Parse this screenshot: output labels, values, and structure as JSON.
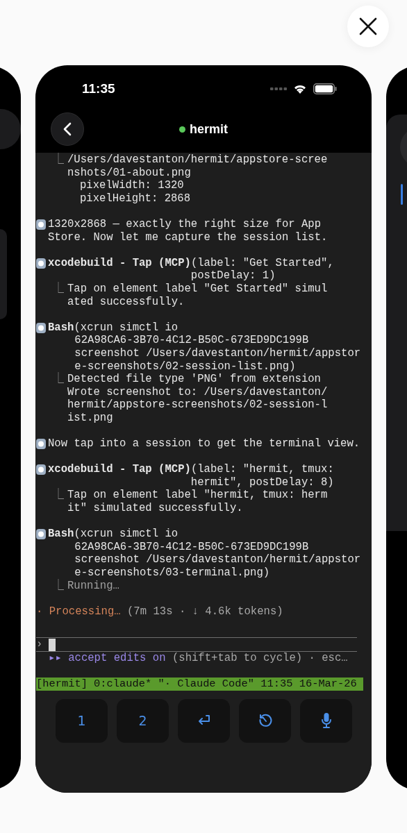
{
  "status_bar": {
    "time": "11:35"
  },
  "nav": {
    "title": "hermit",
    "connected": true
  },
  "transcript": [
    {
      "kind": "result",
      "marker": "⎿",
      "lines": [
        "/Users/davestanton/hermit/appstore-scree",
        "nshots/01-about.png"
      ],
      "details": [
        "pixelWidth: 1320",
        "pixelHeight: 2868"
      ]
    },
    {
      "kind": "message",
      "lines": [
        "1320x2868 — exactly the right size for App",
        "Store. Now let me capture the session list."
      ]
    },
    {
      "kind": "mcp",
      "name": "xcodebuild - Tap (MCP)",
      "args": [
        "(label: \"Get Started\",",
        "postDelay: 1)"
      ],
      "result": [
        "Tap on element label \"Get Started\" simul",
        "ated successfully."
      ],
      "marker": "⎿",
      "running": false
    },
    {
      "kind": "bash",
      "name": "Bash",
      "args": [
        "(xcrun simctl io",
        "62A98CA6-3B70-4C12-B50C-673ED9DC199B",
        "screenshot /Users/davestanton/hermit/appstor",
        "e-screenshots/02-session-list.png)"
      ],
      "marker": "⎿",
      "result": [
        "Detected file type 'PNG' from extension",
        "Wrote screenshot to: /Users/davestanton/",
        "hermit/appstore-screenshots/02-session-l",
        "ist.png"
      ],
      "running": false
    },
    {
      "kind": "message",
      "lines": [
        "Now tap into a session to get the terminal view."
      ]
    },
    {
      "kind": "mcp",
      "name": "xcodebuild - Tap (MCP)",
      "args": [
        "(label: \"hermit, tmux:",
        "hermit\", postDelay: 8)"
      ],
      "result": [
        "Tap on element label \"hermit, tmux: herm",
        "it\" simulated successfully."
      ],
      "marker": "⎿",
      "running": false
    },
    {
      "kind": "bash",
      "name": "Bash",
      "args": [
        "(xcrun simctl io",
        "62A98CA6-3B70-4C12-B50C-673ED9DC199B",
        "screenshot /Users/davestanton/hermit/appstor",
        "e-screenshots/03-terminal.png)"
      ],
      "result": [
        "Running…"
      ],
      "marker": "⎿",
      "running": true
    }
  ],
  "activity": {
    "verb": "· Processing…",
    "detail": "(7m 13s · ↓ 4.6k tokens)"
  },
  "prompt": {
    "symbol": "›"
  },
  "mode": {
    "icon": "▸▸",
    "label": "accept edits on",
    "hint": "(shift+tab to cycle) · esc…"
  },
  "tmux_status": "[hermit] 0:claude* \"· Claude Code\" 11:35 16-Mar-26",
  "keys": [
    {
      "kind": "text",
      "label": "1"
    },
    {
      "kind": "text",
      "label": "2"
    },
    {
      "kind": "return"
    },
    {
      "kind": "history"
    },
    {
      "kind": "mic"
    }
  ]
}
